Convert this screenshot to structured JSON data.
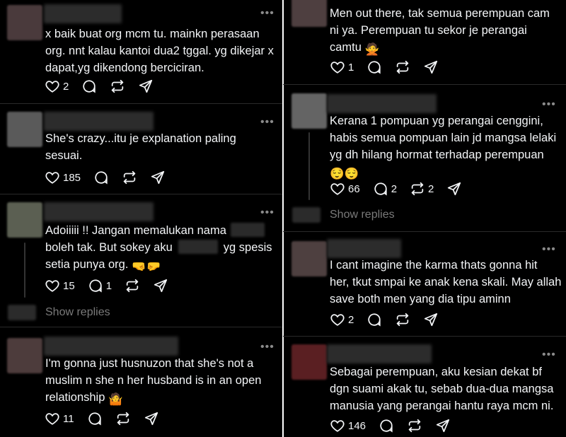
{
  "colors": {
    "background": "#000000",
    "text": "#f3f5f7",
    "muted": "#7a7a7a",
    "divider": "#2a2a2a"
  },
  "icons": {
    "like": "heart-icon",
    "reply": "comment-icon",
    "repost": "repost-icon",
    "share": "send-icon",
    "more": "more-icon"
  },
  "left_posts": [
    {
      "lines": [
        "x baik buat org mcm tu. mainkn perasaan",
        "org. nnt kalau kantoi dua2 tggal. yg dikejar x",
        "dapat,yg dikendong berciciran."
      ],
      "likes": "2",
      "replies": "",
      "reposts": ""
    },
    {
      "lines": [
        "She's crazy...itu je explanation paling",
        "sesuai."
      ],
      "likes": "185",
      "replies": "",
      "reposts": ""
    },
    {
      "line1": "Adoiiiii !! Jangan  memalukan nama",
      "line2a": "boleh tak. But sokey aku",
      "line2b": "yg spesis",
      "line3": "setia punya org.",
      "emoji": "🤜🤛",
      "likes": "15",
      "replies": "1",
      "reposts": "",
      "show_replies": "Show replies"
    },
    {
      "lines": [
        "I'm gonna just husnuzon that she's not a",
        "muslim n she n her husband is in an open"
      ],
      "line3": "relationship",
      "emoji": "🤷",
      "likes": "11",
      "replies": "",
      "reposts": ""
    }
  ],
  "right_posts": [
    {
      "lines": [
        "Men out there, tak semua perempuan cam",
        "ni ya. Perempuan tu sekor je perangai"
      ],
      "line3": "camtu",
      "emoji": "🙅",
      "likes": "1",
      "replies": "",
      "reposts": ""
    },
    {
      "lines": [
        "Kerana 1 pompuan yg perangai cenggini,",
        "habis semua pompuan lain jd mangsa lelaki",
        "yg dh hilang hormat terhadap perempuan"
      ],
      "emoji": "😌😌",
      "likes": "66",
      "replies": "2",
      "reposts": "2",
      "show_replies": "Show replies"
    },
    {
      "lines": [
        "I cant imagine the karma thats gonna hit",
        "her, tkut smpai ke anak kena skali. May allah",
        "save both men yang dia tipu aminn"
      ],
      "likes": "2",
      "replies": "",
      "reposts": ""
    },
    {
      "lines": [
        "Sebagai perempuan, aku kesian dekat bf",
        "dgn suami akak tu, sebab dua-dua mangsa",
        "manusia yang perangai hantu raya mcm ni."
      ],
      "likes": "146",
      "replies": "",
      "reposts": ""
    }
  ]
}
